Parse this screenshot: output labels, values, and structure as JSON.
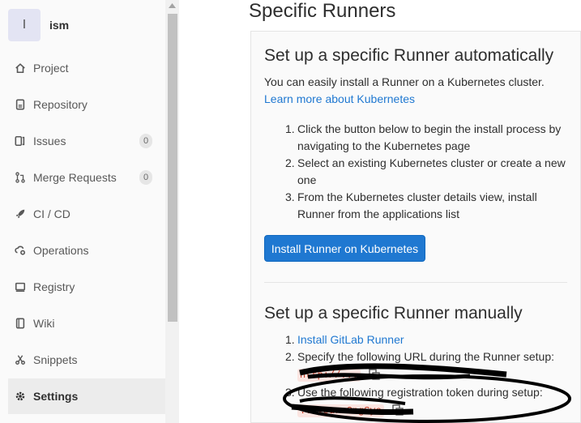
{
  "sidebar": {
    "project_avatar": "I",
    "project_name": "ism",
    "items": [
      {
        "label": "Project",
        "icon": "home-icon"
      },
      {
        "label": "Repository",
        "icon": "doc-icon"
      },
      {
        "label": "Issues",
        "icon": "issues-icon",
        "badge": "0"
      },
      {
        "label": "Merge Requests",
        "icon": "merge-request-icon",
        "badge": "0"
      },
      {
        "label": "CI / CD",
        "icon": "rocket-icon"
      },
      {
        "label": "Operations",
        "icon": "cloud-gear-icon"
      },
      {
        "label": "Registry",
        "icon": "registry-icon"
      },
      {
        "label": "Wiki",
        "icon": "book-icon"
      },
      {
        "label": "Snippets",
        "icon": "snippet-icon"
      },
      {
        "label": "Settings",
        "icon": "gear-icon"
      }
    ]
  },
  "main": {
    "page_title": "Specific Runners",
    "auto": {
      "title": "Set up a specific Runner automatically",
      "intro": "You can easily install a Runner on a Kubernetes cluster.",
      "learn_link": "Learn more about Kubernetes",
      "steps": [
        [
          "Click the button below to begin the install process by",
          "navigating to the Kubernetes page"
        ],
        [
          "Select an existing Kubernetes cluster or create a new",
          "one"
        ],
        [
          "From the Kubernetes cluster details view, install",
          "Runner from the applications list"
        ]
      ],
      "install_button": "Install Runner on Kubernetes"
    },
    "manual": {
      "title": "Set up a specific Runner manually",
      "steps": [
        {
          "prefix": "",
          "link": "Install GitLab Runner"
        },
        {
          "prefix": "Specify the following URL during the Runner setup:",
          "value": "http://..."
        },
        {
          "prefix": "Use the following registration token during setup:",
          "value": "...yourcCngSye"
        }
      ]
    }
  }
}
